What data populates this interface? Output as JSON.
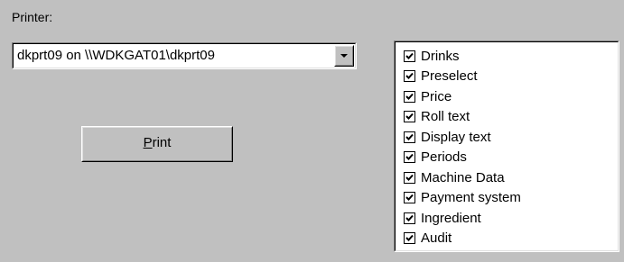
{
  "printer": {
    "label": "Printer:",
    "selected": "dkprt09 on \\\\WDKGAT01\\dkprt09"
  },
  "print_button": {
    "mnemonic": "P",
    "rest": "rint"
  },
  "checklist": {
    "items": [
      {
        "label": "Drinks",
        "checked": true
      },
      {
        "label": "Preselect",
        "checked": true
      },
      {
        "label": "Price",
        "checked": true
      },
      {
        "label": "Roll text",
        "checked": true
      },
      {
        "label": "Display text",
        "checked": true
      },
      {
        "label": "Periods",
        "checked": true
      },
      {
        "label": "Machine Data",
        "checked": true
      },
      {
        "label": "Payment system",
        "checked": true
      },
      {
        "label": "Ingredient",
        "checked": true
      },
      {
        "label": "Audit",
        "checked": true
      }
    ]
  }
}
